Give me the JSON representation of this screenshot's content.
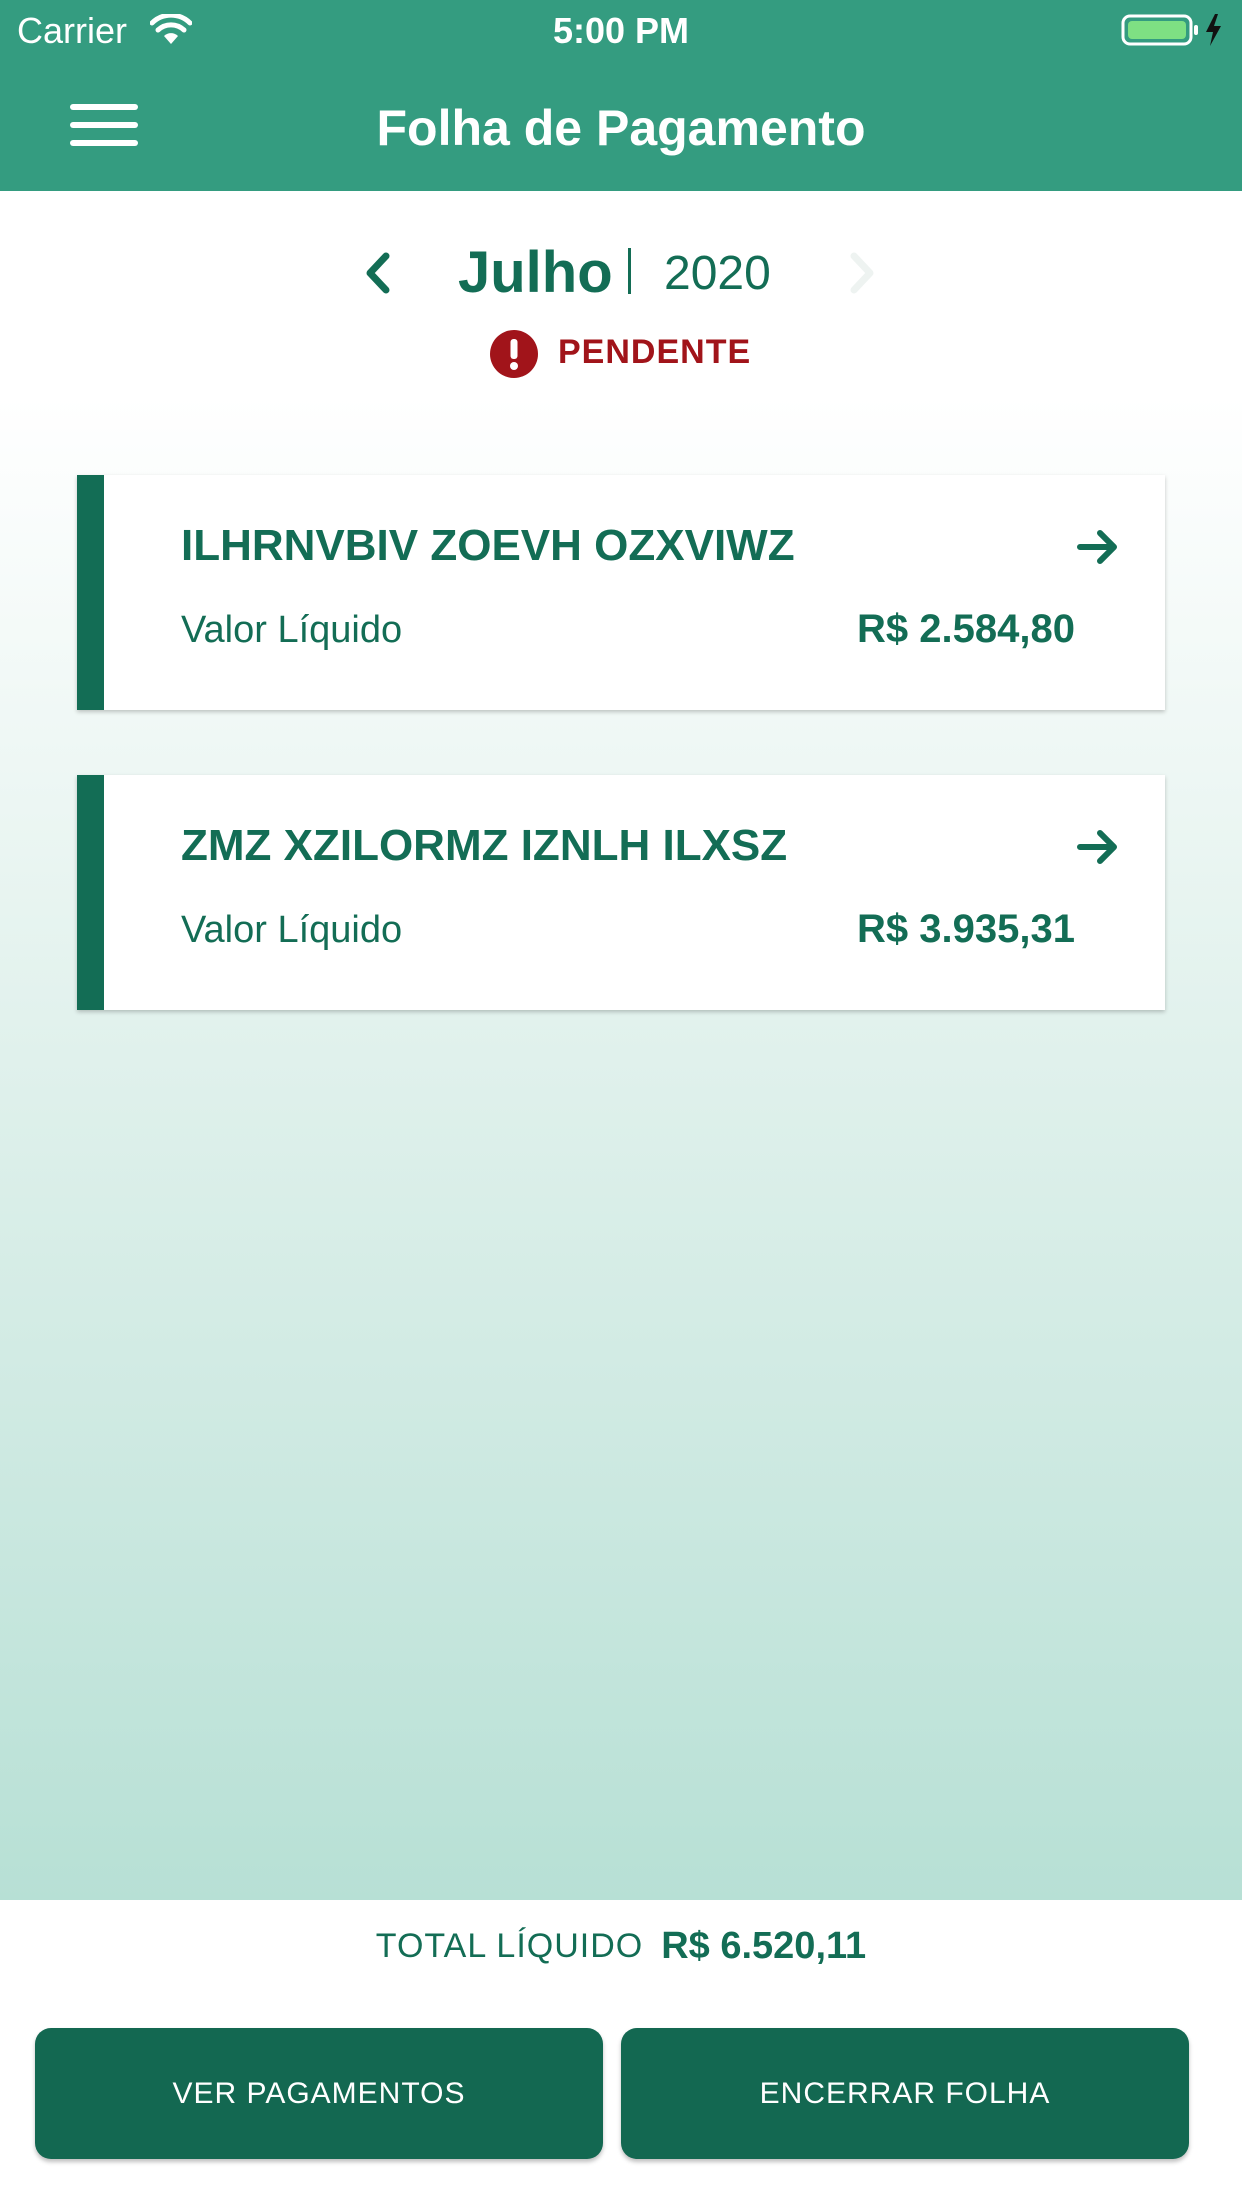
{
  "status_bar": {
    "carrier": "Carrier",
    "time": "5:00 PM",
    "wifi_icon": "wifi-icon",
    "battery_icon": "battery-charging-icon"
  },
  "header": {
    "title": "Folha de Pagamento",
    "menu_icon": "hamburger-menu-icon"
  },
  "period": {
    "month": "Julho",
    "year": "2020",
    "status": "PENDENTE",
    "status_icon": "alert-circle-icon",
    "status_color": "#a1141a",
    "prev_icon": "chevron-left-icon",
    "next_icon": "chevron-right-icon"
  },
  "employees": [
    {
      "name": "ILHRNVBIV ZOEVH OZXVIWZ",
      "label": "Valor Líquido",
      "value": "R$ 2.584,80"
    },
    {
      "name": "ZMZ XZILORMZ IZNLH ILXSZ",
      "label": "Valor Líquido",
      "value": "R$ 3.935,31"
    }
  ],
  "footer": {
    "total_label": "TOTAL LÍQUIDO",
    "total_value": "R$ 6.520,11",
    "btn_payments": "VER PAGAMENTOS",
    "btn_close": "ENCERRAR FOLHA"
  },
  "colors": {
    "header": "#349c80",
    "primary": "#136d55",
    "button": "#136851",
    "alert": "#a1141a"
  }
}
